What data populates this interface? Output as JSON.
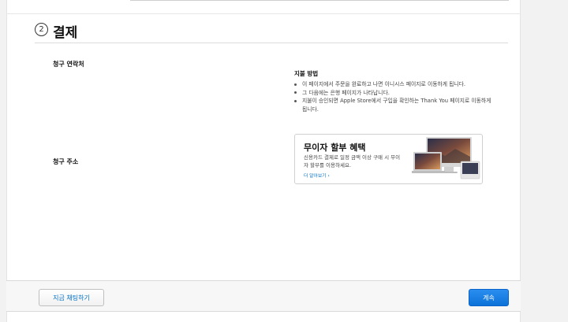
{
  "section": {
    "step_number": "2",
    "title": "결제"
  },
  "billing": {
    "contact_label": "청구 연락처",
    "address_label": "청구 주소"
  },
  "payment_method": {
    "title": "지불 방법",
    "bullets": [
      "이 페이지에서 주문을 완료하고 나면 이니시스 페이지로 이동하게 됩니다.",
      "그 다음에는 은행 페이지가 나타납니다.",
      "지불이 승인되면 Apple Store에서 구입을 확인하는 Thank You 페이지로 이동하게 됩니다."
    ]
  },
  "promo": {
    "title": "무이자 할부 혜택",
    "description": "신용카드 결제로 일정 금액 이상 구매 시 무이자 할부를 이용하세요.",
    "link": "더 알아보기 ›"
  },
  "footer": {
    "chat_button": "지금 채팅하기",
    "continue_button": "계속"
  },
  "colors": {
    "accent": "#0070c9",
    "primary_button": "#0d72d8"
  }
}
